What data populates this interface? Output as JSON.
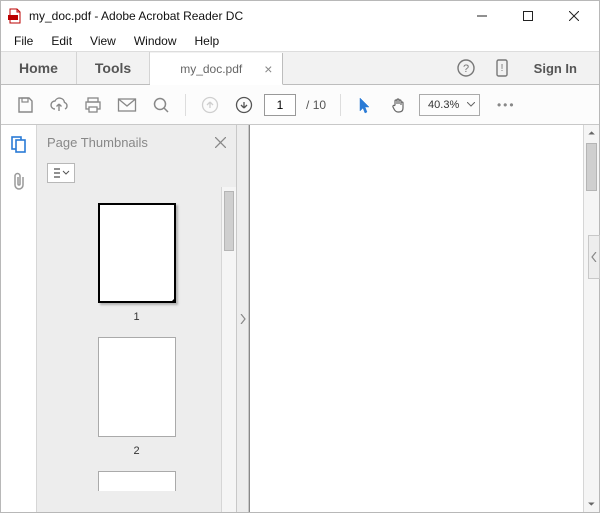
{
  "window": {
    "title": "my_doc.pdf - Adobe Acrobat Reader DC",
    "minimize": "—",
    "maximize": "☐",
    "close": "✕"
  },
  "menu": {
    "file": "File",
    "edit": "Edit",
    "view": "View",
    "window": "Window",
    "help": "Help"
  },
  "tabs": {
    "home": "Home",
    "tools": "Tools",
    "doc": "my_doc.pdf",
    "close": "×",
    "signin": "Sign In"
  },
  "toolbar": {
    "page_current": "1",
    "page_sep": "/",
    "page_total": "10",
    "zoom": "40.3%",
    "more": "•••"
  },
  "thumbnails": {
    "title": "Page Thumbnails",
    "close": "✕",
    "pages": [
      "1",
      "2"
    ]
  }
}
